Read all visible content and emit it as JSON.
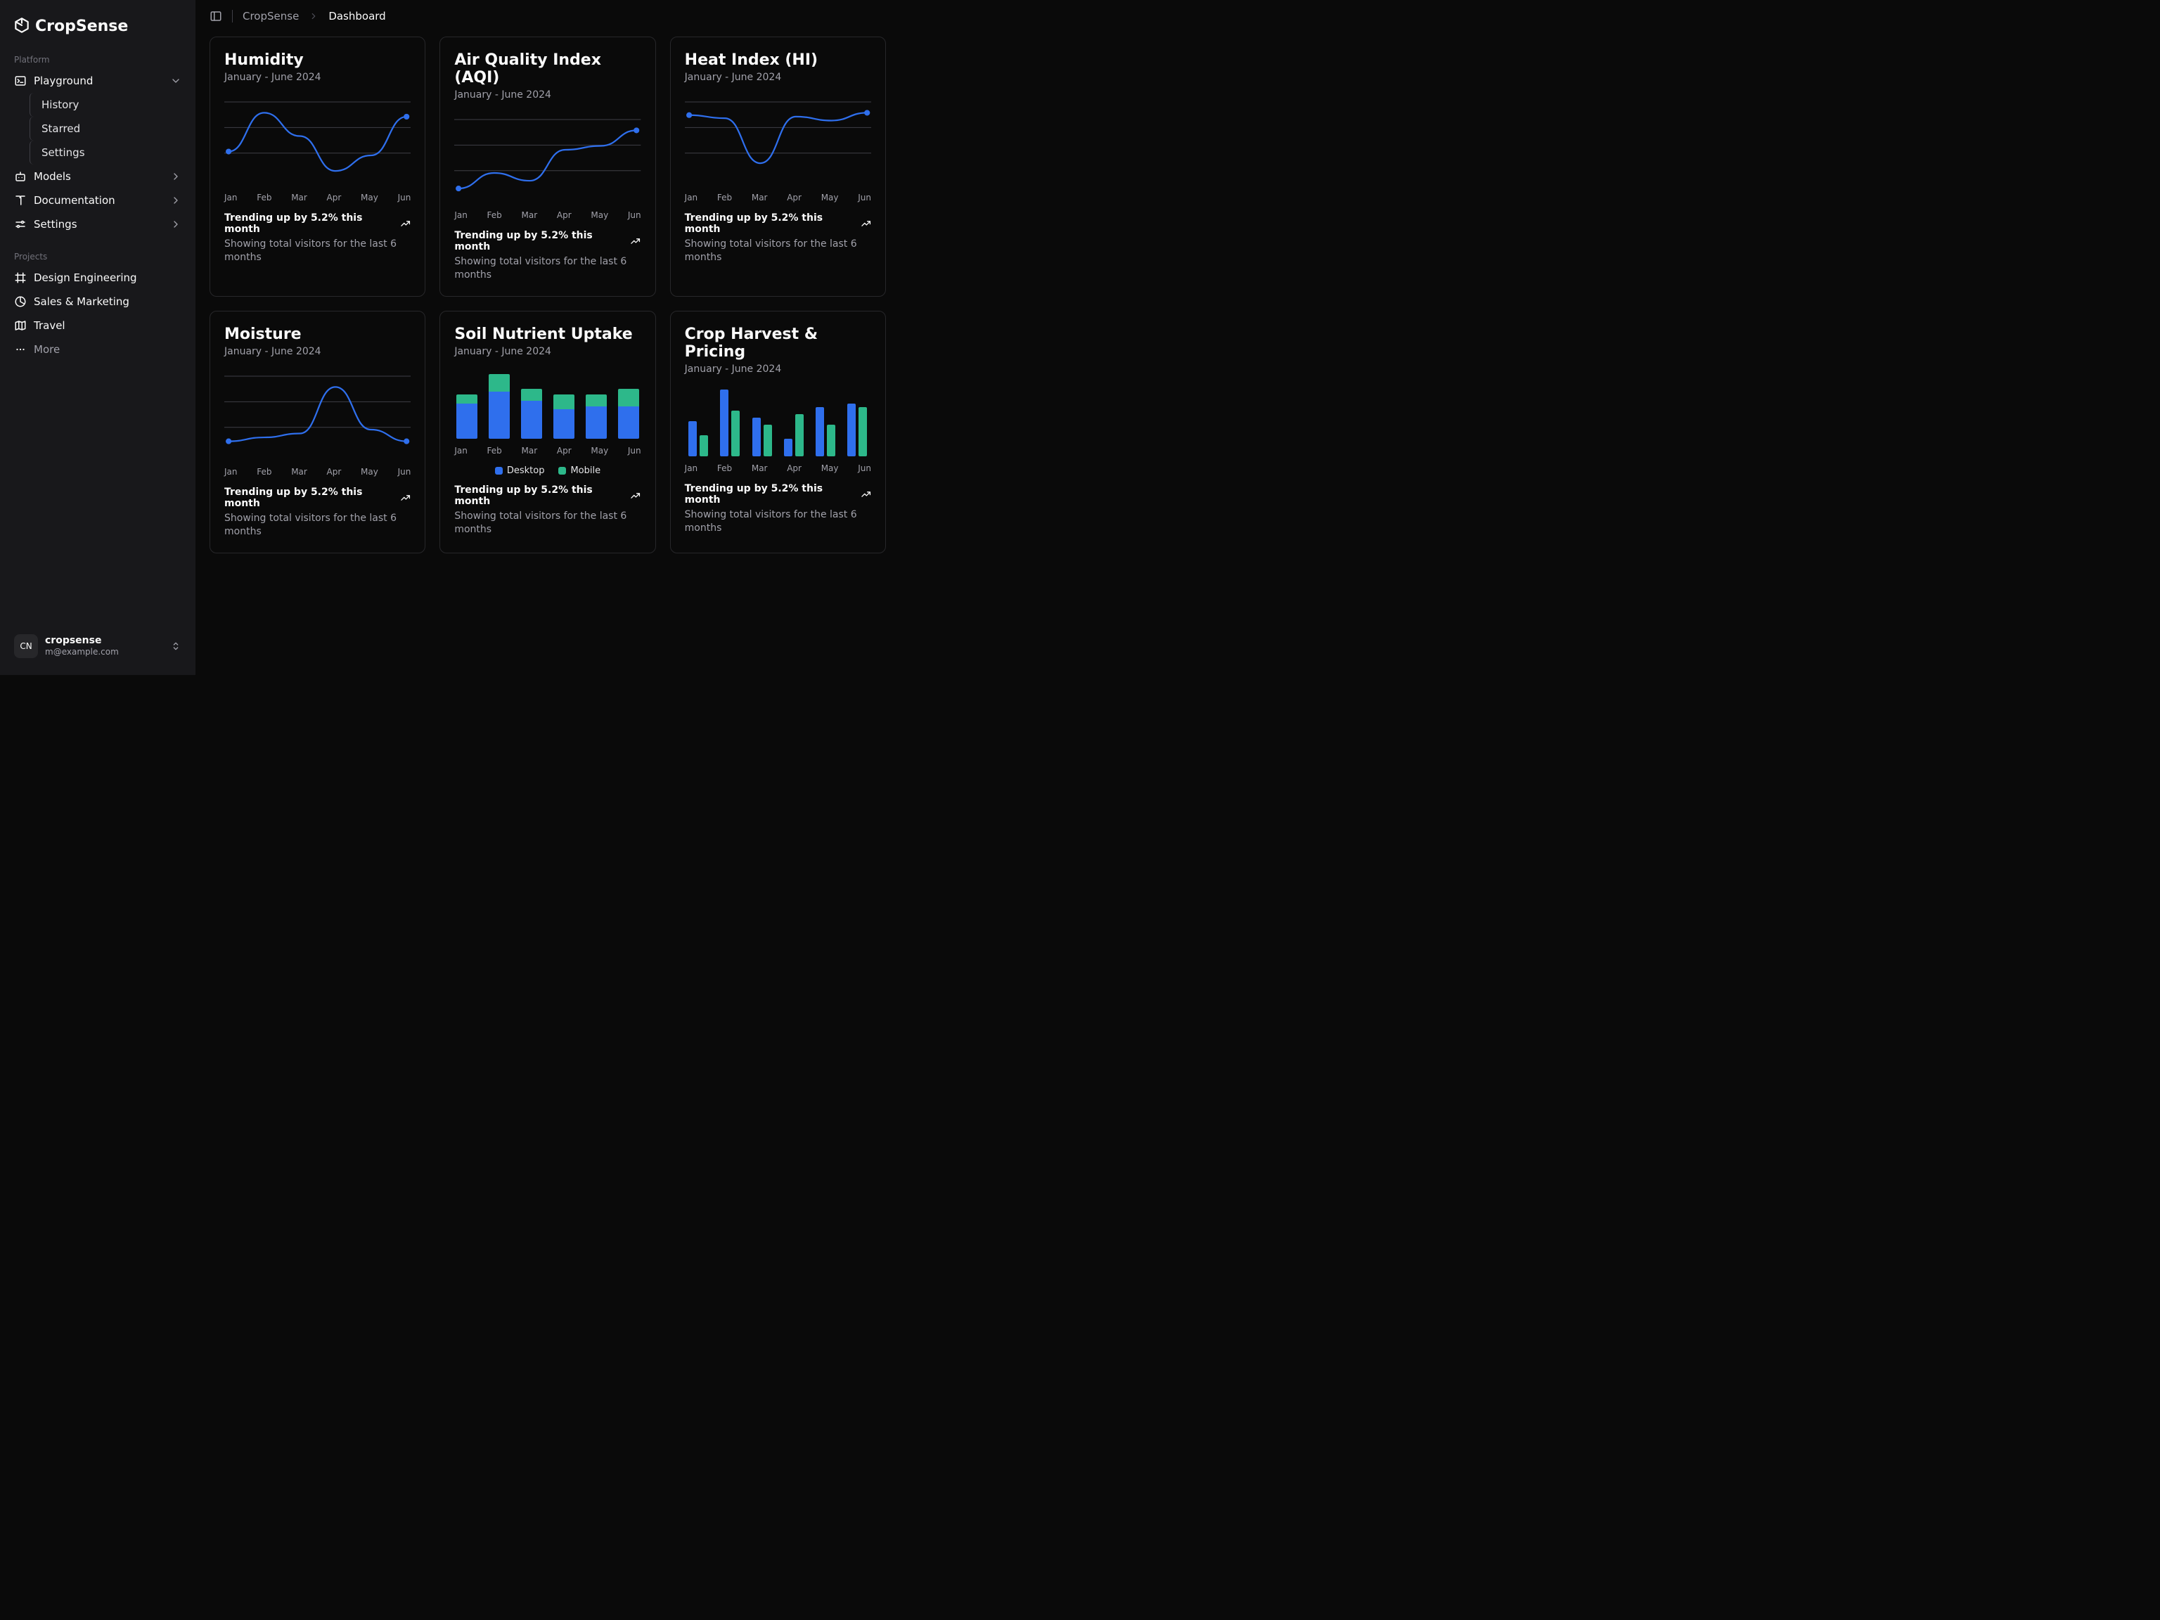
{
  "app_name": "CropSense",
  "sidebar": {
    "platform_label": "Platform",
    "projects_label": "Projects",
    "items": [
      {
        "label": "Playground",
        "expanded": true
      },
      {
        "label": "Models"
      },
      {
        "label": "Documentation"
      },
      {
        "label": "Settings"
      }
    ],
    "playground_sub": [
      {
        "label": "History"
      },
      {
        "label": "Starred"
      },
      {
        "label": "Settings"
      }
    ],
    "projects": [
      {
        "label": "Design Engineering"
      },
      {
        "label": "Sales & Marketing"
      },
      {
        "label": "Travel"
      },
      {
        "label": "More"
      }
    ]
  },
  "user": {
    "initials": "CN",
    "name": "cropsense",
    "email": "m@example.com"
  },
  "breadcrumb": {
    "root": "CropSense",
    "current": "Dashboard"
  },
  "common": {
    "subtitle": "January - June 2024",
    "trend": "Trending up by 5.2% this month",
    "desc": "Showing total visitors for the last 6 months"
  },
  "cards": [
    {
      "title": "Humidity"
    },
    {
      "title": "Air Quality Index (AQI)"
    },
    {
      "title": "Heat Index (HI)"
    },
    {
      "title": "Moisture"
    },
    {
      "title": "Soil Nutrient Uptake"
    },
    {
      "title": "Crop Harvest & Pricing"
    }
  ],
  "months": [
    "Jan",
    "Feb",
    "Mar",
    "Apr",
    "May",
    "Jun"
  ],
  "legend": {
    "a": "Desktop",
    "b": "Mobile"
  },
  "colors": {
    "blue": "#2f6fed",
    "teal": "#2db88a",
    "grid": "#3f3f46"
  },
  "chart_data": [
    {
      "type": "line",
      "title": "Humidity",
      "x": [
        "Jan",
        "Feb",
        "Mar",
        "Apr",
        "May",
        "Jun"
      ],
      "values": [
        35,
        85,
        55,
        10,
        30,
        80
      ],
      "ylim": [
        0,
        100
      ]
    },
    {
      "type": "line",
      "title": "Air Quality Index (AQI)",
      "x": [
        "Jan",
        "Feb",
        "Mar",
        "Apr",
        "May",
        "Jun"
      ],
      "values": [
        10,
        30,
        20,
        60,
        65,
        85
      ],
      "ylim": [
        0,
        100
      ]
    },
    {
      "type": "line",
      "title": "Heat Index (HI)",
      "x": [
        "Jan",
        "Feb",
        "Mar",
        "Apr",
        "May",
        "Jun"
      ],
      "values": [
        82,
        78,
        20,
        80,
        75,
        85
      ],
      "ylim": [
        0,
        100
      ]
    },
    {
      "type": "line",
      "title": "Moisture",
      "x": [
        "Jan",
        "Feb",
        "Mar",
        "Apr",
        "May",
        "Jun"
      ],
      "values": [
        15,
        20,
        25,
        85,
        30,
        15
      ],
      "ylim": [
        0,
        100
      ]
    },
    {
      "type": "bar",
      "title": "Soil Nutrient Uptake",
      "categories": [
        "Jan",
        "Feb",
        "Mar",
        "Apr",
        "May",
        "Jun"
      ],
      "series": [
        {
          "name": "Desktop",
          "values": [
            60,
            80,
            65,
            50,
            55,
            55
          ]
        },
        {
          "name": "Mobile",
          "values": [
            15,
            30,
            20,
            25,
            20,
            30
          ]
        }
      ],
      "stacked": true,
      "ylim": [
        0,
        120
      ]
    },
    {
      "type": "bar",
      "title": "Crop Harvest & Pricing",
      "categories": [
        "Jan",
        "Feb",
        "Mar",
        "Apr",
        "May",
        "Jun"
      ],
      "series": [
        {
          "name": "Desktop",
          "values": [
            50,
            95,
            55,
            25,
            70,
            75
          ]
        },
        {
          "name": "Mobile",
          "values": [
            30,
            65,
            45,
            60,
            45,
            70
          ]
        }
      ],
      "stacked": false,
      "ylim": [
        0,
        100
      ]
    }
  ]
}
